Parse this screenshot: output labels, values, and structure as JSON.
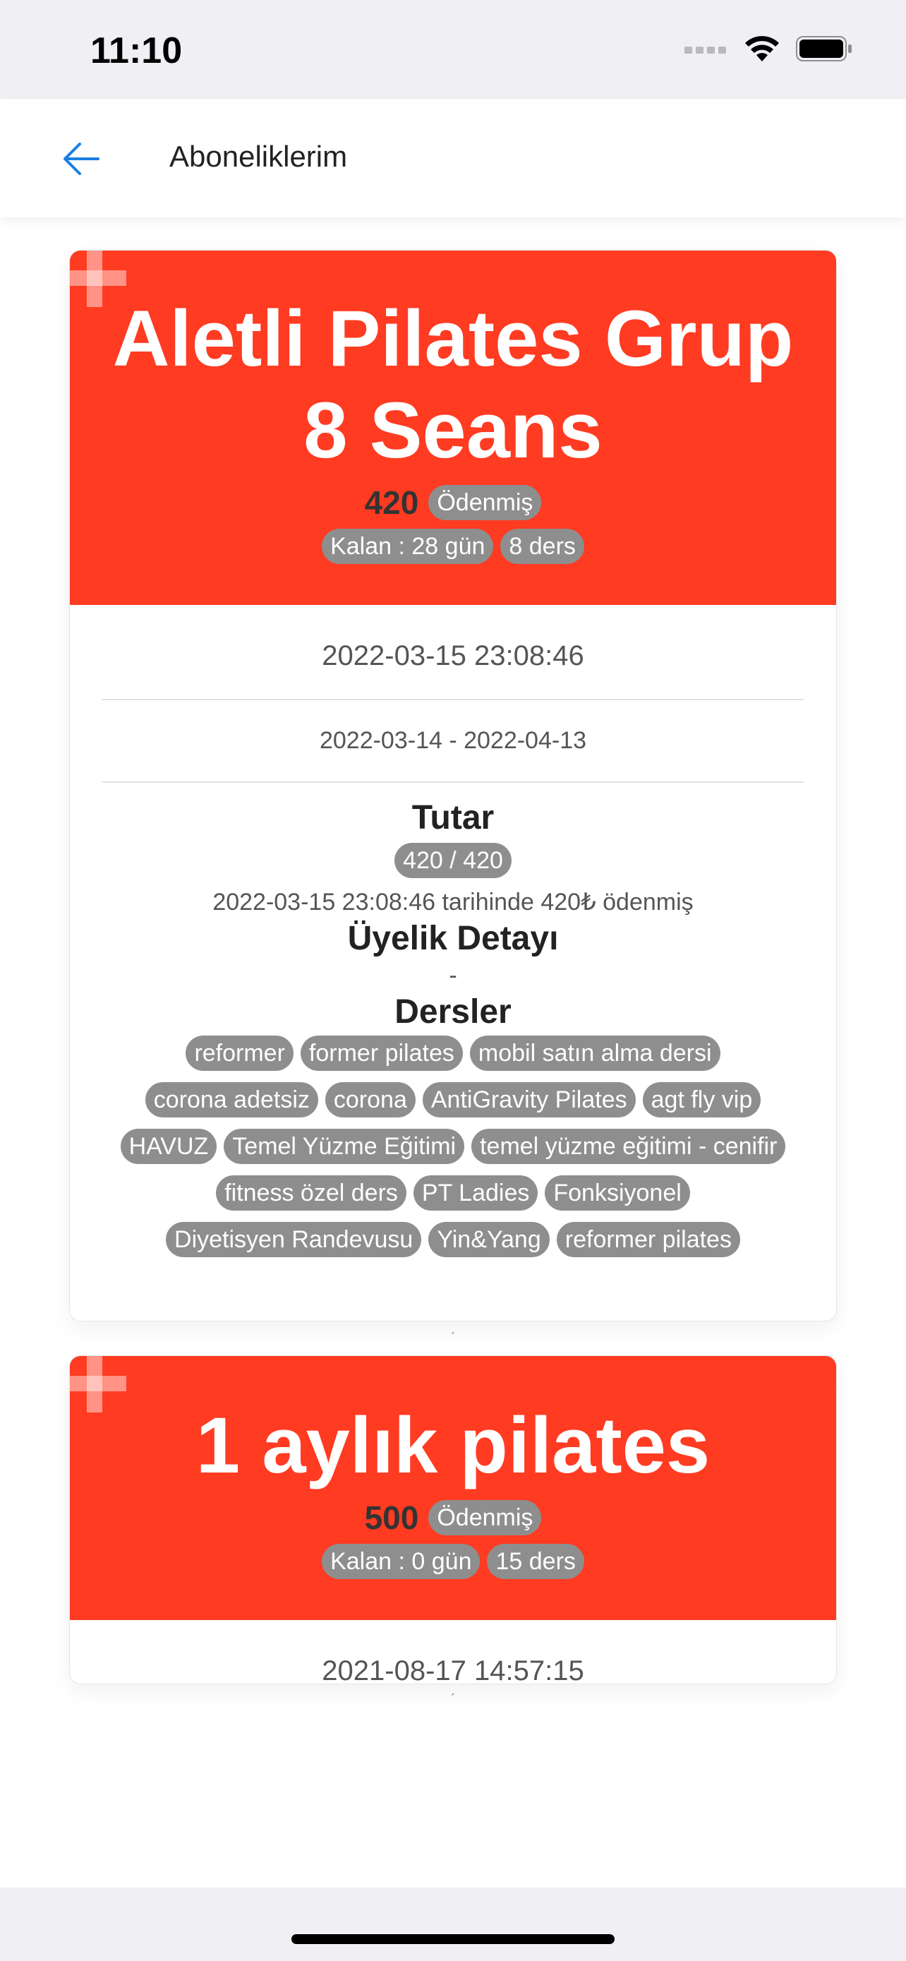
{
  "status_bar": {
    "time": "11:10"
  },
  "header": {
    "title": "Aboneliklerim"
  },
  "subscriptions": [
    {
      "title": "Aletli Pilates Grup 8 Seans",
      "price": "420",
      "paid_status": "Ödenmiş",
      "remaining": "Kalan : 28 gün",
      "lessons": "8 ders",
      "created_at": "2022-03-15 23:08:46",
      "date_range": "2022-03-14 - 2022-04-13",
      "amount_title": "Tutar",
      "amount": "420 / 420",
      "payment_note": "2022-03-15 23:08:46 tarihinde 420₺ ödenmiş",
      "membership_title": "Üyelik Detayı",
      "membership_detail": "-",
      "classes_title": "Dersler",
      "classes": [
        "reformer",
        "former pilates",
        "mobil satın alma dersi",
        "corona adetsiz",
        "corona",
        "AntiGravity Pilates",
        "agt fly vip",
        "HAVUZ",
        "Temel Yüzme Eğitimi",
        "temel yüzme eğitimi - cenifir",
        "fitness özel ders",
        "PT Ladies",
        "Fonksiyonel",
        "Diyetisyen Randevusu",
        "Yin&Yang",
        "reformer pilates"
      ]
    },
    {
      "title": "1 aylık pilates",
      "price": "500",
      "paid_status": "Ödenmiş",
      "remaining": "Kalan : 0 gün",
      "lessons": "15 ders",
      "created_at": "2021-08-17 14:57:15"
    }
  ],
  "colors": {
    "card_header": "#ff3b22",
    "pill": "#8e8e8e",
    "back_arrow": "#1a7fe0"
  }
}
